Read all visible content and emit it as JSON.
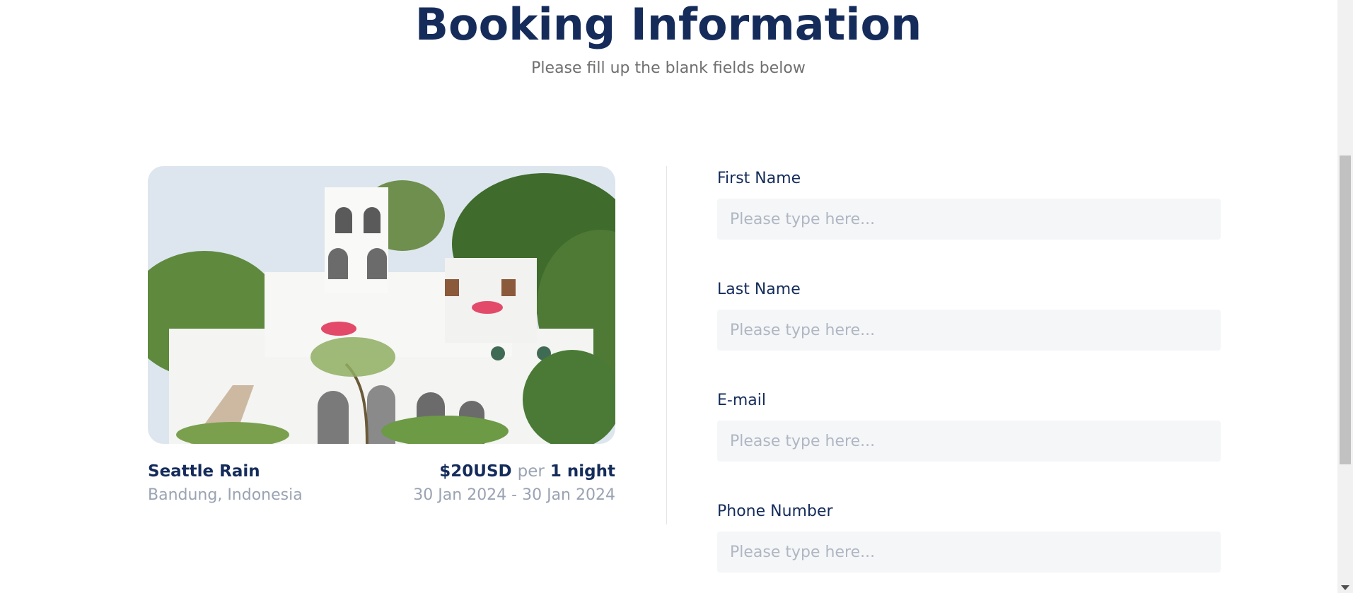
{
  "header": {
    "title": "Booking Information",
    "subtitle": "Please fill up the blank fields below"
  },
  "hotel": {
    "name": "Seattle Rain",
    "location": "Bandung, Indonesia",
    "price": "$20USD",
    "per": "per",
    "duration": "1 night",
    "dates": "30 Jan 2024 - 30 Jan 2024"
  },
  "form": {
    "fields": [
      {
        "label": "First Name",
        "placeholder": "Please type here..."
      },
      {
        "label": "Last Name",
        "placeholder": "Please type here..."
      },
      {
        "label": "E-mail",
        "placeholder": "Please type here..."
      },
      {
        "label": "Phone Number",
        "placeholder": "Please type here..."
      }
    ]
  },
  "colors": {
    "title": "#152c5b",
    "muted": "#9aa3b3",
    "input_bg": "#f5f6f8"
  }
}
